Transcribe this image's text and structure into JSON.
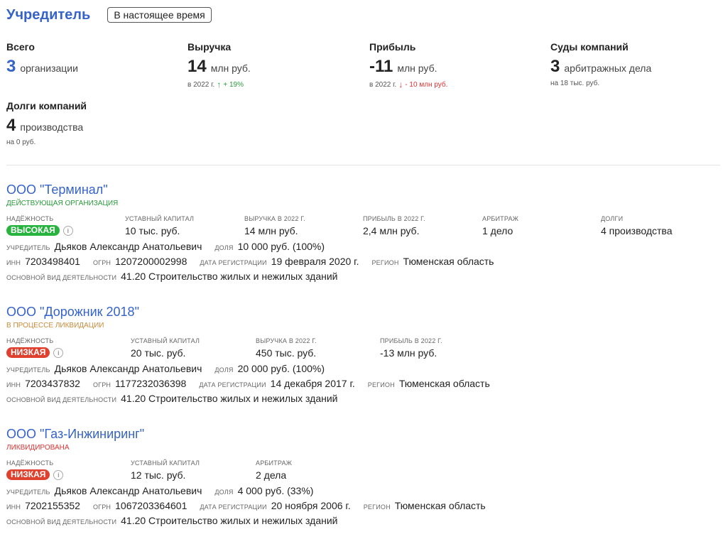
{
  "header": {
    "title": "Учредитель",
    "period_button": "В настоящее время"
  },
  "stats": [
    {
      "label": "Всего",
      "value": "3",
      "unit": "организации",
      "sub": ""
    },
    {
      "label": "Выручка",
      "value": "14",
      "unit": "млн руб.",
      "sub": "в 2022 г.",
      "trend": "+ 19%",
      "trend_dir": "up"
    },
    {
      "label": "Прибыль",
      "value": "-11",
      "unit": "млн руб.",
      "sub": "в 2022 г.",
      "trend": "- 10 млн руб.",
      "trend_dir": "down"
    },
    {
      "label": "Суды компаний",
      "value": "3",
      "unit": "арбитражных дела",
      "sub": "на 18 тыс. руб."
    },
    {
      "label": "Долги компаний",
      "value": "4",
      "unit": "производства",
      "sub": "на 0 руб."
    }
  ],
  "labels": {
    "reliability": "Надёжность",
    "capital": "Уставный капитал",
    "revenue": "Выручка в 2022 г.",
    "profit": "Прибыль в 2022 г.",
    "arbitration": "Арбитраж",
    "debts": "Долги",
    "founder": "Учредитель",
    "share": "доля",
    "inn": "ИНН",
    "ogrn": "ОГРН",
    "reg_date": "Дата регистрации",
    "region": "Регион",
    "activity": "Основной вид деятельности"
  },
  "companies": [
    {
      "name": "ООО \"Терминал\"",
      "status": "Действующая организация",
      "reliability": "ВЫСОКАЯ",
      "capital": "10 тыс. руб.",
      "revenue": "14 млн руб.",
      "profit": "2,4 млн руб.",
      "arbitration": "1 дело",
      "debts": "4 производства",
      "founder": "Дьяков Александр Анатольевич",
      "share": "10 000 руб. (100%)",
      "inn": "7203498401",
      "ogrn": "1207200002998",
      "reg_date": "19 февраля 2020 г.",
      "region": "Тюменская область",
      "activity": "41.20 Строительство жилых и нежилых зданий"
    },
    {
      "name": "ООО \"Дорожник 2018\"",
      "status": "В процессе ликвидации",
      "reliability": "НИЗКАЯ",
      "capital": "20 тыс. руб.",
      "revenue": "450 тыс. руб.",
      "profit": "-13 млн руб.",
      "founder": "Дьяков Александр Анатольевич",
      "share": "20 000 руб. (100%)",
      "inn": "7203437832",
      "ogrn": "1177232036398",
      "reg_date": "14 декабря 2017 г.",
      "region": "Тюменская область",
      "activity": "41.20 Строительство жилых и нежилых зданий"
    },
    {
      "name": "ООО \"Газ-Инжиниринг\"",
      "status": "Ликвидирована",
      "reliability": "НИЗКАЯ",
      "capital": "12 тыс. руб.",
      "arbitration": "2 дела",
      "founder": "Дьяков Александр Анатольевич",
      "share": "4 000 руб. (33%)",
      "inn": "7202155352",
      "ogrn": "1067203364601",
      "reg_date": "20 ноября 2006 г.",
      "region": "Тюменская область",
      "activity": "41.20 Строительство жилых и нежилых зданий"
    }
  ],
  "colors": {
    "accent": "#3563c9",
    "good": "#27b43e",
    "bad": "#e0412f"
  }
}
